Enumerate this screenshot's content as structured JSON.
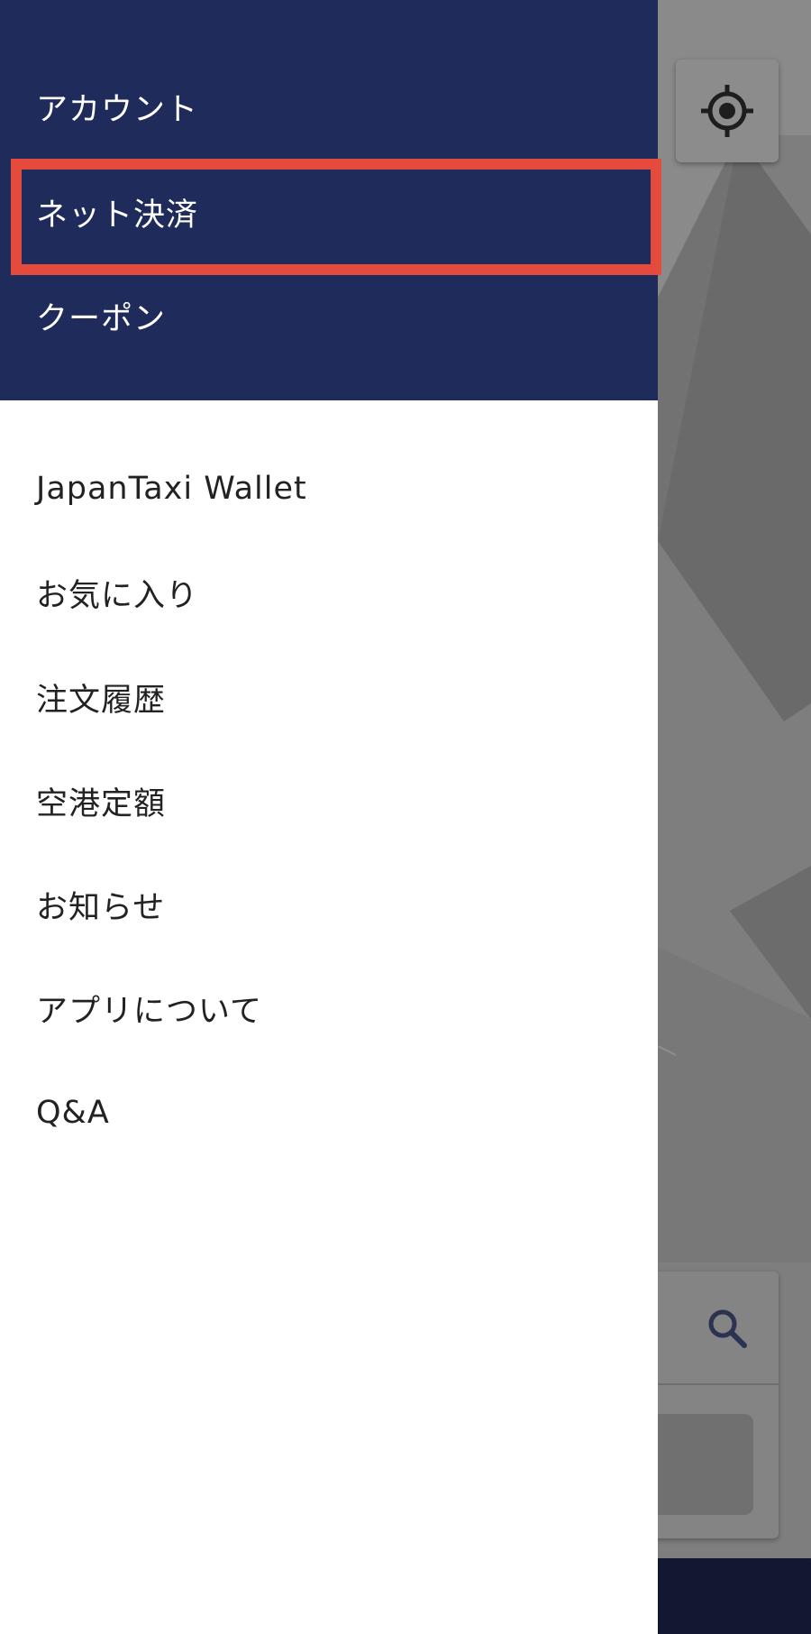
{
  "colors": {
    "drawer_header": "#1f2b5b",
    "highlight_border": "#e54b3c",
    "map_overlay": "#7b7b7b"
  },
  "drawer": {
    "header_items": [
      {
        "label": "アカウント"
      },
      {
        "label": "ネット決済",
        "highlighted": true
      },
      {
        "label": "クーポン"
      }
    ],
    "menu_items": [
      {
        "label": "JapanTaxi Wallet"
      },
      {
        "label": "お気に入り"
      },
      {
        "label": "注文履歴"
      },
      {
        "label": "空港定額"
      },
      {
        "label": "お知らせ"
      },
      {
        "label": "アプリについて"
      },
      {
        "label": "Q&A"
      }
    ]
  },
  "map": {
    "locate_icon": "crosshair-icon",
    "search_icon": "search-icon"
  }
}
